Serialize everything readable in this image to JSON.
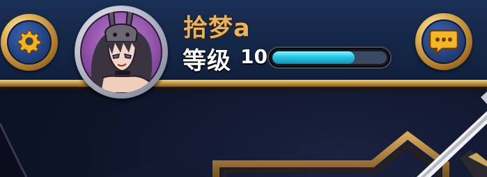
{
  "player": {
    "name": "拾梦a",
    "level_label": "等级",
    "level_value": "10",
    "xp_progress": 0.72
  },
  "buttons": {
    "settings_icon": "gear-icon",
    "chat_icon": "speech-bubble-icon"
  },
  "colors": {
    "name": "#e9b25e",
    "xp_fill": "#25c6e6",
    "gold_trim": "#c99a3e",
    "topbar": "#142646"
  }
}
